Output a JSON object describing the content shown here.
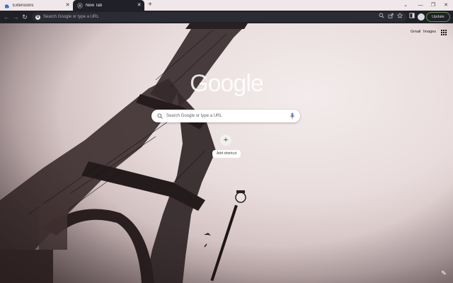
{
  "tabs": [
    {
      "title": "Extensions",
      "favicon": "puzzle-icon",
      "close": "✕"
    },
    {
      "title": "New Tab",
      "favicon": "chrome-icon",
      "close": "✕"
    }
  ],
  "new_tab_symbol": "+",
  "window_controls": {
    "chevron": "⌄",
    "minimize": "—",
    "restore": "❐",
    "close": "✕"
  },
  "toolbar": {
    "back": "←",
    "forward": "→",
    "reload": "↻",
    "omnibox_placeholder": "Search Google or type a URL",
    "update_label": "Update"
  },
  "ntp": {
    "gmail_link": "Gmail",
    "images_link": "Images",
    "logo_text": "Google",
    "search_placeholder": "Search Google or type a URL",
    "add_shortcut_symbol": "+",
    "add_shortcut_label": "Add shortcut",
    "customize_symbol": "✎"
  },
  "colors": {
    "tab_strip": "#efe7e9",
    "active_tab": "#202127",
    "update_border": "#5c8f4f"
  }
}
